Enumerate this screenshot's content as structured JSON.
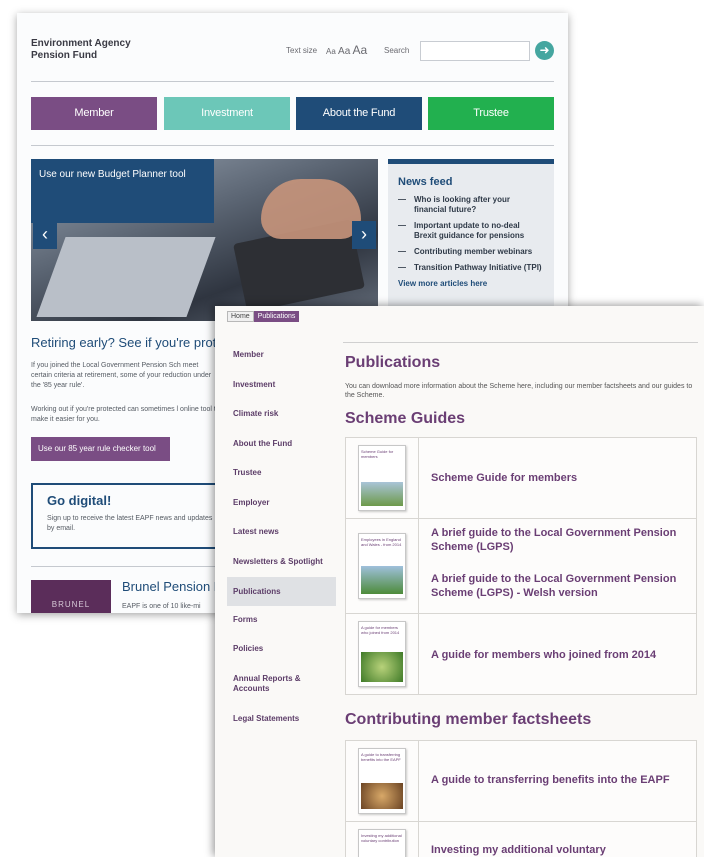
{
  "back": {
    "org_name": "Environment Agency Pension Fund",
    "text_size_label": "Text size",
    "text_sizes": [
      "Aa",
      "Aa",
      "Aa"
    ],
    "search_label": "Search",
    "search_go_icon": "arrow-right-icon",
    "nav": [
      {
        "label": "Member",
        "color": "#7a4d84"
      },
      {
        "label": "Investment",
        "color": "#6cc7b8"
      },
      {
        "label": "About the Fund",
        "color": "#1f4c78"
      },
      {
        "label": "Trustee",
        "color": "#22b04f"
      }
    ],
    "hero_caption": "Use our new Budget Planner tool",
    "hero_prev_icon": "chevron-left-icon",
    "hero_next_icon": "chevron-right-icon",
    "news": {
      "title": "News feed",
      "items": [
        "Who is looking after your financial future?",
        "Important update to no-deal Brexit guidance for pensions",
        "Contributing member webinars",
        "Transition Pathway Initiative (TPI)"
      ],
      "more": "View more articles here"
    },
    "retire_heading": "Retiring early? See if you're prote",
    "retire_para1": "If you joined the Local Government Pension Sch meet certain criteria at retirement, some of your reduction under the '85 year rule'.",
    "retire_para2": "Working out if you're protected can sometimes l online tool to make it easier for you.",
    "rule85_button": "Use our 85 year rule checker tool",
    "digital": {
      "title": "Go digital!",
      "text": "Sign up to receive the latest EAPF news and updates by email."
    },
    "brunel_logo": "BRUNEL",
    "brunel_title": "Brunel Pension P",
    "brunel_text": "EAPF is one of 10 like-mi"
  },
  "front": {
    "breadcrumb": [
      "Home",
      "Publications"
    ],
    "sidebar": [
      "Member",
      "Investment",
      "Climate risk",
      "About the Fund",
      "Trustee",
      "Employer",
      "Latest news",
      "Newsletters & Spotlight",
      "Publications",
      "Forms",
      "Policies",
      "Annual Reports & Accounts",
      "Legal Statements"
    ],
    "active_sidebar": "Publications",
    "page_title": "Publications",
    "intro": "You can download more information about the Scheme here, including our member factsheets and our guides to the Scheme.",
    "section1_title": "Scheme Guides",
    "guides": [
      {
        "thumb_title": "Scheme Guide for members",
        "links": [
          "Scheme Guide for members"
        ]
      },
      {
        "thumb_title": "Employees in England and Wales - from 2014",
        "links": [
          "A brief guide to the Local Government Pension Scheme (LGPS)",
          "A brief guide to the Local Government Pension Scheme (LGPS) - Welsh version"
        ]
      },
      {
        "thumb_title": "A guide for members who joined from 2014",
        "links": [
          "A guide for members who joined from 2014"
        ]
      }
    ],
    "section2_title": "Contributing member factsheets",
    "factsheets": [
      {
        "thumb_title": "A guide to transferring benefits into the EAPF",
        "links": [
          "A guide to transferring benefits into the EAPF"
        ]
      },
      {
        "thumb_title": "Investing my additional voluntary contribution",
        "links": [
          "Investing my additional voluntary"
        ]
      }
    ]
  }
}
